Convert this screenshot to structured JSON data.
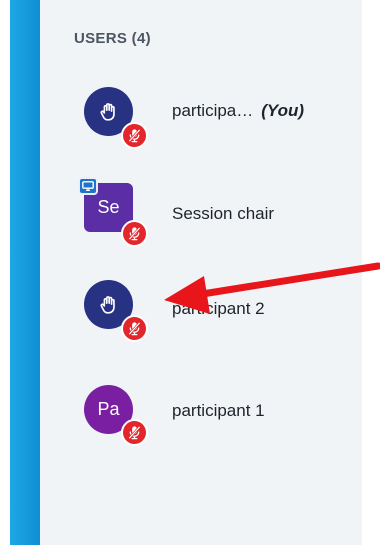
{
  "panel": {
    "header": "USERS (4)"
  },
  "users": [
    {
      "name": "participa…",
      "you_label": "(You)",
      "avatar_text": "",
      "avatar_color": "#283283",
      "avatar_icon": "raised-hand-icon",
      "mic_status": "muted"
    },
    {
      "name": "Session chair",
      "avatar_text": "Se",
      "avatar_color": "#5b2ea6",
      "presenter": true,
      "mic_status": "muted"
    },
    {
      "name": "participant 2",
      "avatar_text": "",
      "avatar_color": "#283283",
      "avatar_icon": "raised-hand-icon",
      "mic_status": "muted"
    },
    {
      "name": "participant 1",
      "avatar_text": "Pa",
      "avatar_color": "#7a1fa2",
      "mic_status": "muted"
    }
  ],
  "colors": {
    "accent_strip": "#1fa7e6",
    "mic_muted": "#e2262c",
    "annotation_arrow": "#e8151b"
  }
}
